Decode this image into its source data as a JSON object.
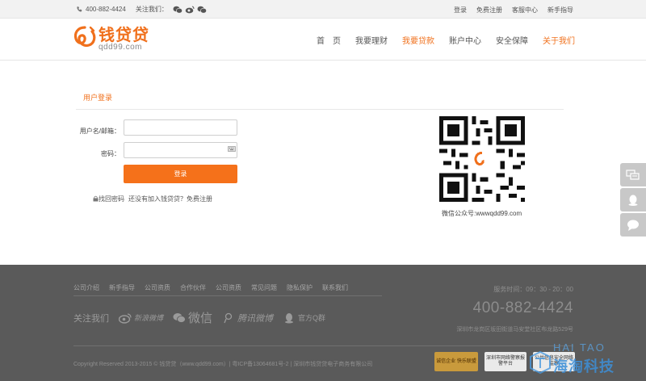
{
  "topbar": {
    "phone": "400-882-4424",
    "follow_label": "关注我们：",
    "links": [
      "登录",
      "免费注册",
      "客服中心",
      "新手指导"
    ]
  },
  "header": {
    "logo_cn": "钱贷贷",
    "logo_en": "qdd99.com",
    "nav": [
      "首　页",
      "我要理财",
      "我要贷款",
      "账户中心",
      "安全保障",
      "关于我们"
    ],
    "nav_active_index": 2,
    "accent_color": "#f0701c"
  },
  "login": {
    "title": "用户登录",
    "username_label": "用户名/邮箱：",
    "username_value": "",
    "password_label": "密码：",
    "password_value": "",
    "submit_label": "登录",
    "forgot_label": "找回密码",
    "register_label": "还没有加入钱贷贷？免费注册",
    "qr_caption": "微信公众号:wwwqdd99.com"
  },
  "float_bar": {
    "icons": [
      "chat-icon",
      "qq-icon",
      "message-icon"
    ]
  },
  "footer": {
    "links": [
      "公司介绍",
      "新手指导",
      "公司资质",
      "合作伙伴",
      "公司资质",
      "常见问题",
      "隐私保护",
      "联系我们"
    ],
    "follow_label": "关注我们",
    "sns": {
      "weibo": "新浪微博",
      "weixin": "微信",
      "tencent": "腾讯微博",
      "qq": "官方Q群"
    },
    "service_hours": "服务时间：09：30 - 20：00",
    "hotline": "400-882-4424",
    "address": "深圳市龙岗区坂田街道马安堂社区布龙路529号",
    "copyright": "Copyright Reserved 2013-2015 © 钱贷贷（www.qdd99.com）| 粤ICP备13064681号-2 | 深圳市钱贷贷电子商务有限公司",
    "badges": [
      "诚信企业 快乐联盟",
      "深圳市网络警察报警平台",
      "公共信息安全网络监察"
    ]
  },
  "watermark": {
    "top": "HAI TAO",
    "main": "海淘科技"
  }
}
